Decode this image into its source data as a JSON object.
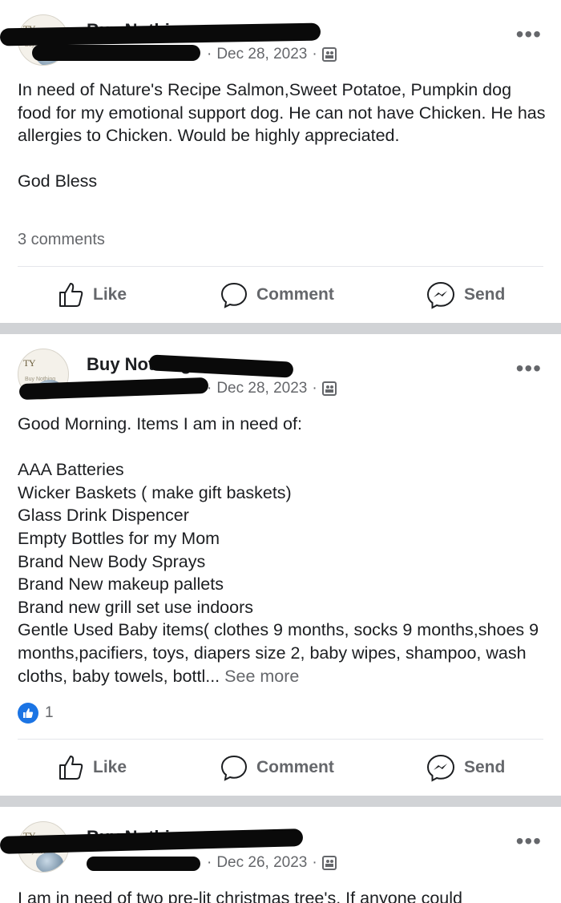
{
  "posts": [
    {
      "group_name": "Buy Nothing",
      "date": "Dec 28, 2023",
      "body": "In need of Nature's Recipe Salmon,Sweet Potatoe, Pumpkin dog food for my emotional support dog. He can not have Chicken. He has allergies to Chicken. Would be highly appreciated.\n\nGod Bless",
      "comments": "3 comments",
      "like_label": "Like",
      "comment_label": "Comment",
      "send_label": "Send"
    },
    {
      "group_name": "Buy Nothing",
      "date": "Dec 28, 2023",
      "body": "Good Morning. Items I am in need of:\n\nAAA Batteries\nWicker Baskets ( make gift baskets)\nGlass Drink Dispencer\nEmpty Bottles for my Mom\nBrand New Body Sprays\nBrand New makeup pallets\nBrand new grill set use indoors\nGentle Used Baby items( clothes 9 months, socks 9 months,shoes 9 months,pacifiers, toys, diapers size 2, baby wipes, shampoo, wash cloths, baby towels, bottl... ",
      "see_more": "See more",
      "reaction_count": "1",
      "like_label": "Like",
      "comment_label": "Comment",
      "send_label": "Send"
    },
    {
      "group_name": "Buy Nothing",
      "date": "Dec 26, 2023",
      "body": "I am in need of two pre-lit christmas tree's. If anyone could"
    }
  ],
  "more_glyph": "•••",
  "dot": "·",
  "avatar_text": "TY",
  "avatar_subtext": "Buy Nothing",
  "colors": {
    "accent": "#1b74e4",
    "muted": "#65676b",
    "separator": "#d1d3d6"
  }
}
